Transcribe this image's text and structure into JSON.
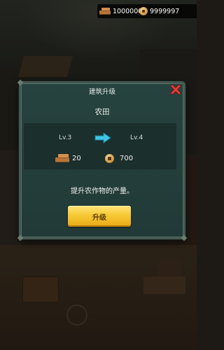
{
  "currency": {
    "wood_icon": "wood-planks-icon",
    "wood_amount": "1000000",
    "coin_icon": "copper-coin-icon",
    "coin_amount": "9999997"
  },
  "dialog": {
    "title": "建筑升级",
    "close_icon": "close-x-icon",
    "building_name": "农田",
    "level_from": "Lv.3",
    "level_to": "Lv.4",
    "arrow_icon": "right-arrow-icon",
    "cost_wood": "20",
    "cost_coin": "700",
    "description": "提升农作物的产量。",
    "upgrade_label": "升级"
  },
  "colors": {
    "dialog_bg": "#24403c",
    "panel_bg": "#1b2f2c",
    "button_yellow": "#f7c935",
    "arrow_cyan": "#3fc6e6",
    "close_red": "#d6332e"
  }
}
